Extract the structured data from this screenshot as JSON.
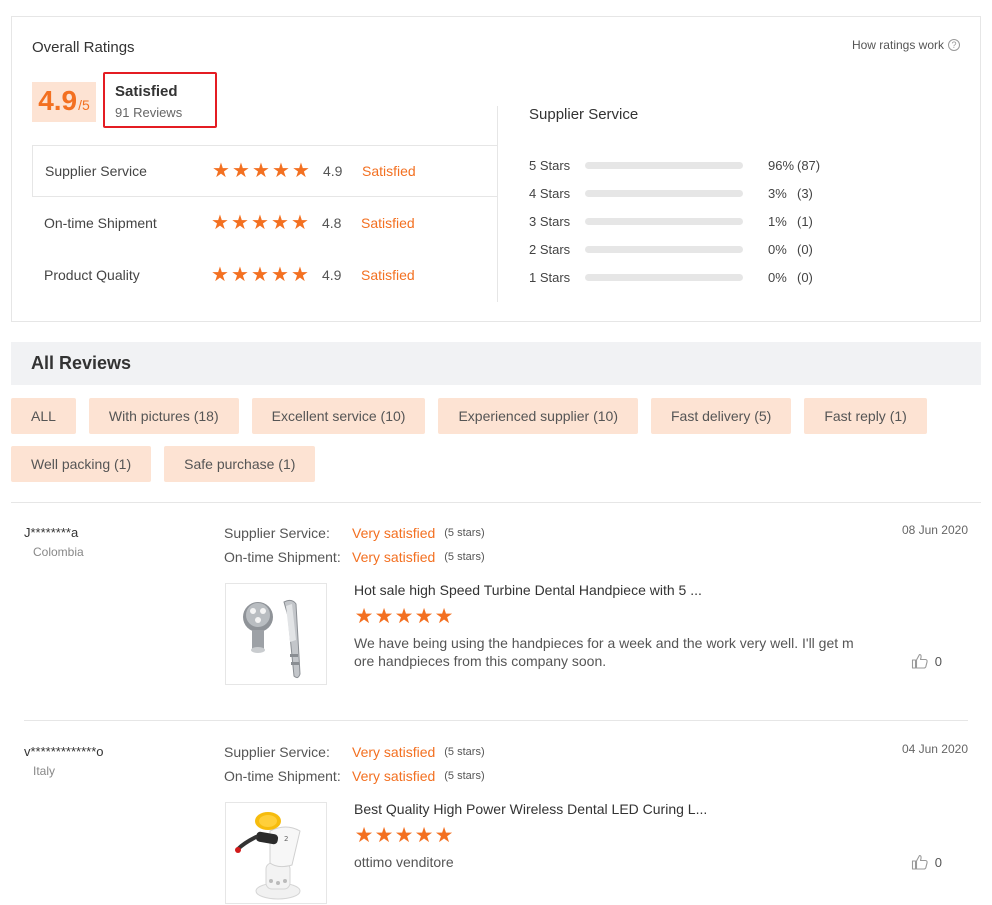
{
  "ratings": {
    "title": "Overall Ratings",
    "how_link": "How ratings work",
    "score": "4.9",
    "score_suffix": "/5",
    "summary": "Satisfied",
    "reviews_count": "91 Reviews",
    "rows": [
      {
        "label": "Supplier Service",
        "stars": 5,
        "score": "4.9",
        "status": "Satisfied"
      },
      {
        "label": "On-time Shipment",
        "stars": 5,
        "score": "4.8",
        "status": "Satisfied"
      },
      {
        "label": "Product Quality",
        "stars": 5,
        "score": "4.9",
        "status": "Satisfied"
      }
    ],
    "distribution_title": "Supplier Service",
    "distribution": [
      {
        "label": "5  Stars",
        "fraction": 0.96,
        "pct": "96%",
        "count": "(87)"
      },
      {
        "label": "4  Stars",
        "fraction": 0.03,
        "pct": "3%",
        "count": "(3)"
      },
      {
        "label": "3  Stars",
        "fraction": 0.01,
        "pct": "1%",
        "count": "(1)"
      },
      {
        "label": "2  Stars",
        "fraction": 0.0,
        "pct": "0%",
        "count": "(0)"
      },
      {
        "label": "1  Stars",
        "fraction": 0.0,
        "pct": "0%",
        "count": "(0)"
      }
    ]
  },
  "all_reviews": {
    "title": "All Reviews",
    "filters": [
      "ALL",
      "With pictures (18)",
      "Excellent service (10)",
      "Experienced supplier (10)",
      "Fast delivery (5)",
      "Fast reply (1)",
      "Well packing (1)",
      "Safe purchase (1)"
    ]
  },
  "reviews": [
    {
      "user": "J********a",
      "country": "Colombia",
      "date": "08 Jun 2020",
      "meta": [
        {
          "key": "Supplier Service:",
          "value": "Very satisfied",
          "stars": "(5 stars)"
        },
        {
          "key": "On-time Shipment:",
          "value": "Very satisfied",
          "stars": "(5 stars)"
        }
      ],
      "product_title": "Hot sale high Speed Turbine Dental Handpiece with 5 ...",
      "rating": 5,
      "text": "We have being using the handpieces for a week and the work very well. I'll get more handpieces from this company soon.",
      "likes": "0"
    },
    {
      "user": "v*************o",
      "country": "Italy",
      "date": "04 Jun 2020",
      "meta": [
        {
          "key": "Supplier Service:",
          "value": "Very satisfied",
          "stars": "(5 stars)"
        },
        {
          "key": "On-time Shipment:",
          "value": "Very satisfied",
          "stars": "(5 stars)"
        }
      ],
      "product_title": "Best Quality High Power Wireless Dental LED Curing L...",
      "rating": 5,
      "text": "ottimo venditore",
      "likes": "0"
    }
  ],
  "colors": {
    "accent": "#f37021",
    "chip_bg": "#fde3d3",
    "highlight_border": "#e41c23"
  },
  "icons": {
    "star": "star-icon",
    "like": "thumbs-up-icon",
    "help": "question-circle-icon"
  }
}
